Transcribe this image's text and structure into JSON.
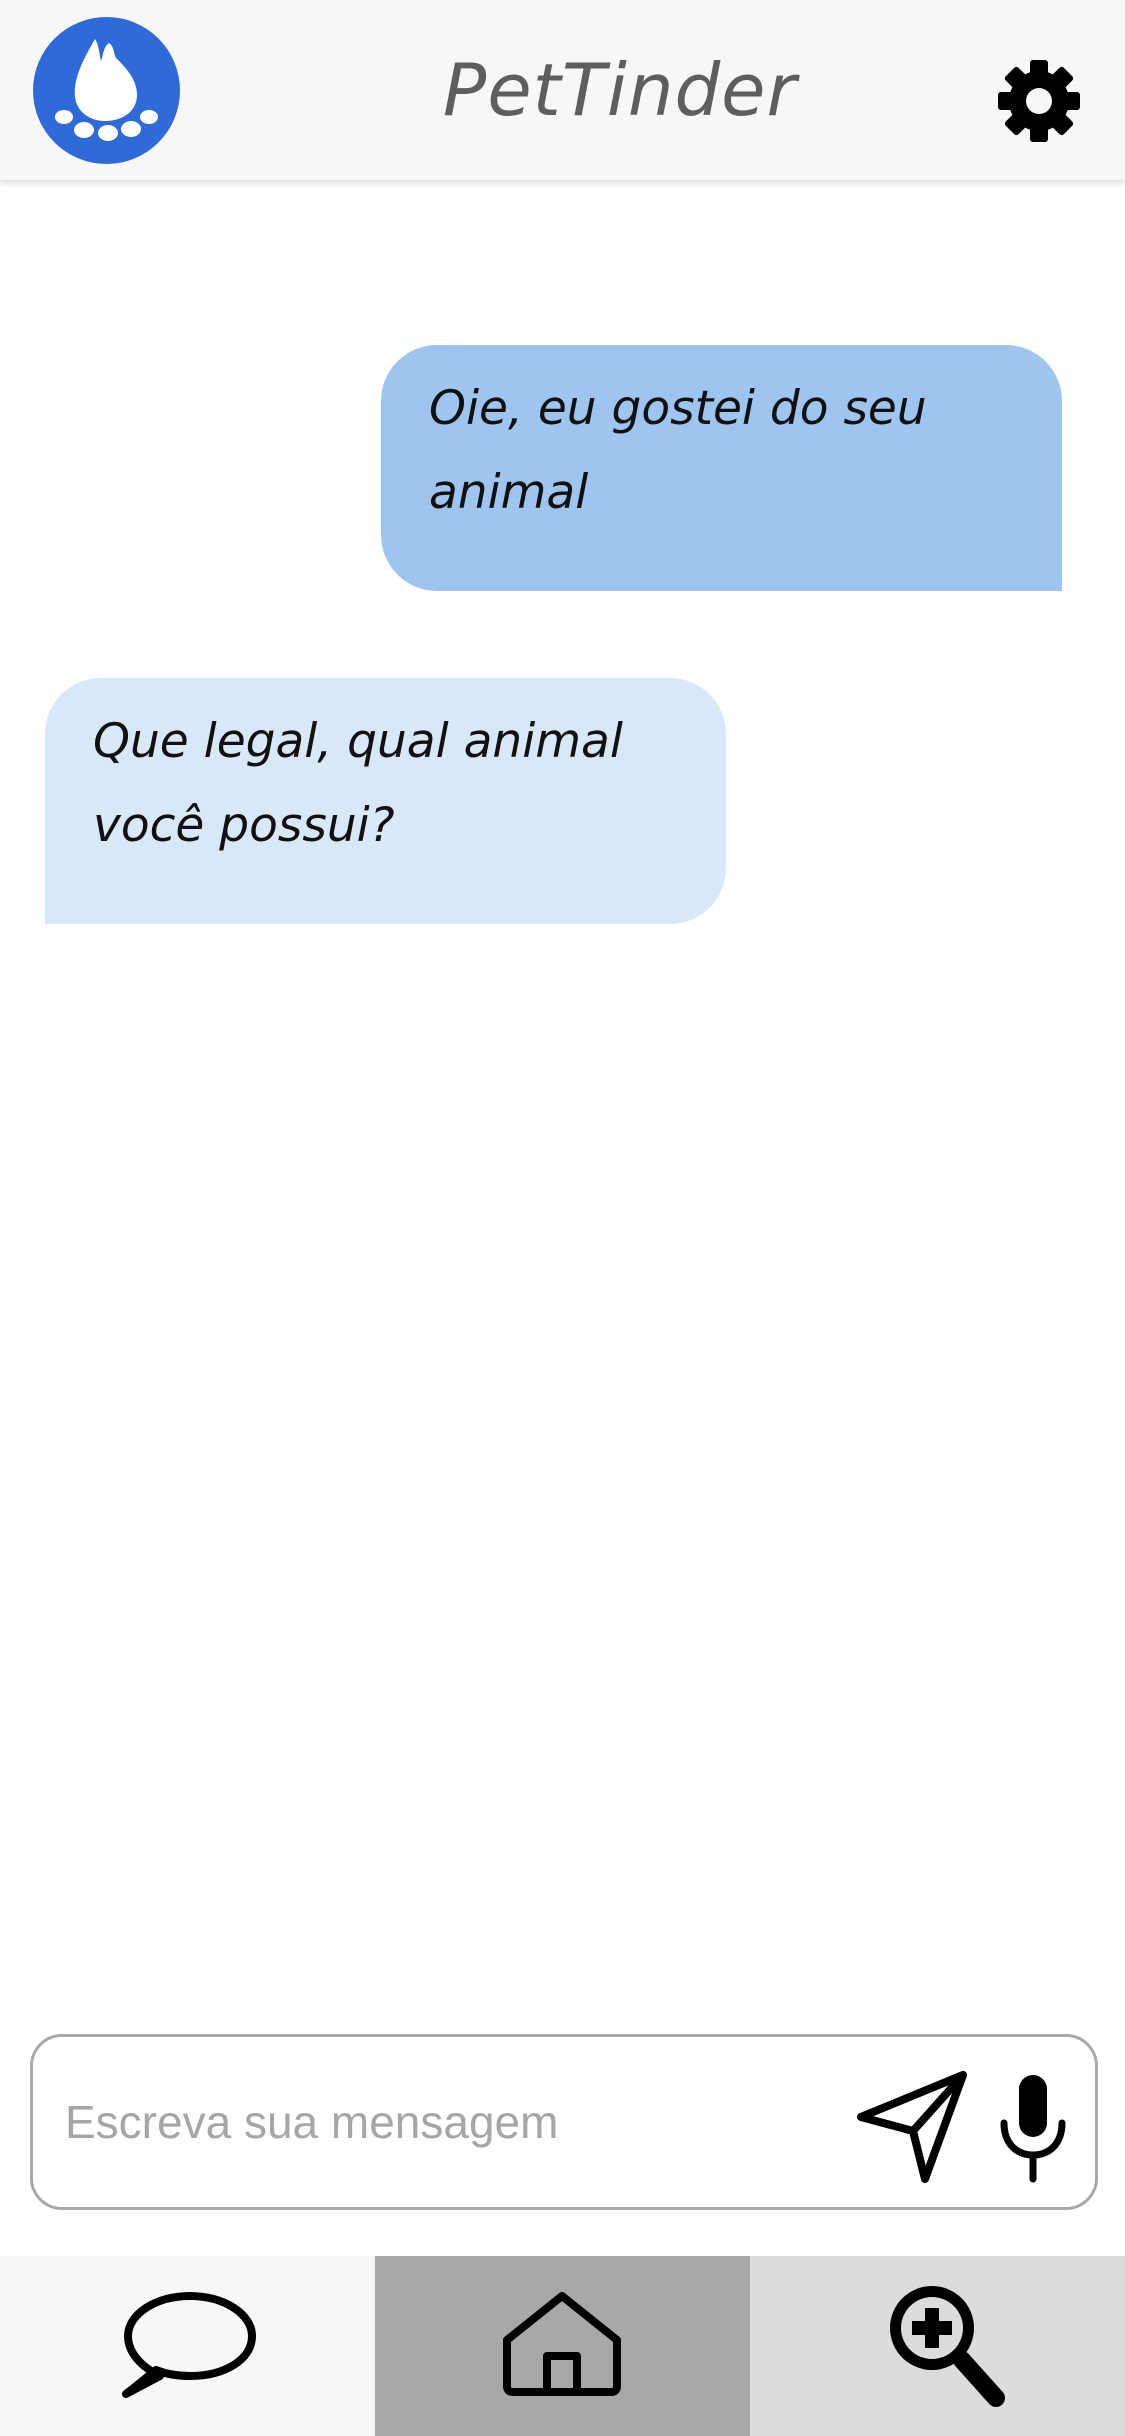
{
  "header": {
    "title": "PetTinder",
    "logo_icon": "paw-icon",
    "settings_icon": "gear-icon"
  },
  "messages": [
    {
      "direction": "sent",
      "lines": [
        "Oie, eu gostei do seu",
        "animal"
      ]
    },
    {
      "direction": "received",
      "lines": [
        "Que legal, qual animal",
        "você possui?"
      ]
    }
  ],
  "composer": {
    "value": "",
    "placeholder": "Escreva sua mensagem",
    "send_icon": "send-icon",
    "mic_icon": "microphone-icon"
  },
  "bottom_nav": {
    "tabs": [
      {
        "icon": "chat-bubble-icon",
        "background": "#f7f7f7"
      },
      {
        "icon": "home-icon",
        "background": "#a8a8a8"
      },
      {
        "icon": "zoom-in-icon",
        "background": "#dcdcdc"
      }
    ]
  },
  "colors": {
    "brand_blue": "#2f6bd8",
    "sent_bubble": "#9dc5f0",
    "received_bubble": "#d9e8f8",
    "title_gray": "#5e5e5e"
  }
}
